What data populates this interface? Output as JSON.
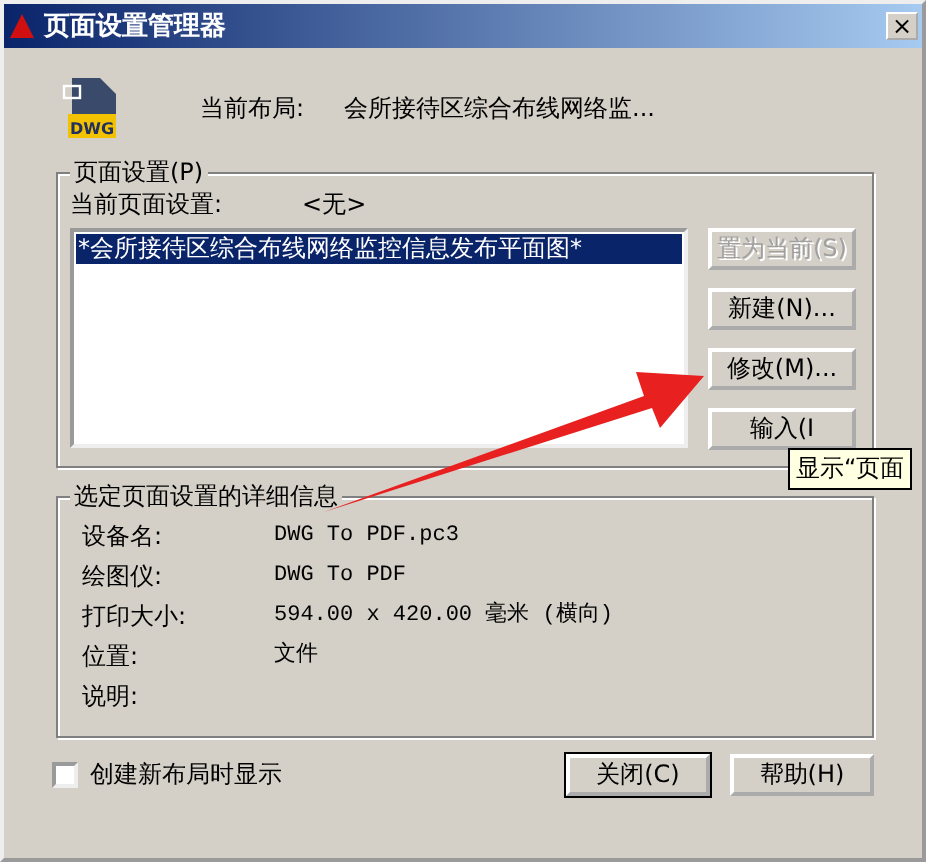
{
  "window": {
    "title": "页面设置管理器",
    "close": "×"
  },
  "file_icon": {
    "label": "DWG"
  },
  "current_layout": {
    "label": "当前布局:",
    "value": "会所接待区综合布线网络监..."
  },
  "page_setups": {
    "title": "页面设置(P)",
    "current_label": "当前页面设置:",
    "current_value": "<无>",
    "items": [
      {
        "label": "*会所接待区综合布线网络监控信息发布平面图*",
        "selected": true
      }
    ],
    "buttons": [
      {
        "label": "置为当前(S)",
        "disabled": true
      },
      {
        "label": "新建(N)...",
        "disabled": false
      },
      {
        "label": "修改(M)...",
        "disabled": false
      },
      {
        "label": "输入(I",
        "disabled": false
      }
    ]
  },
  "tooltip": "显示“页面",
  "details": {
    "title": "选定页面设置的详细信息",
    "rows": [
      {
        "label": "设备名:",
        "value": "DWG To PDF.pc3"
      },
      {
        "label": "绘图仪:",
        "value": "DWG To PDF"
      },
      {
        "label": "打印大小:",
        "value": "594.00 x 420.00 毫米 (横向)"
      },
      {
        "label": "位置:",
        "value": "文件"
      },
      {
        "label": "说明:"
      }
    ]
  },
  "show_on_new_layout": {
    "label": "创建新布局时显示",
    "checked": false
  },
  "footer_buttons": [
    "关闭(C)",
    "帮助(H)"
  ]
}
